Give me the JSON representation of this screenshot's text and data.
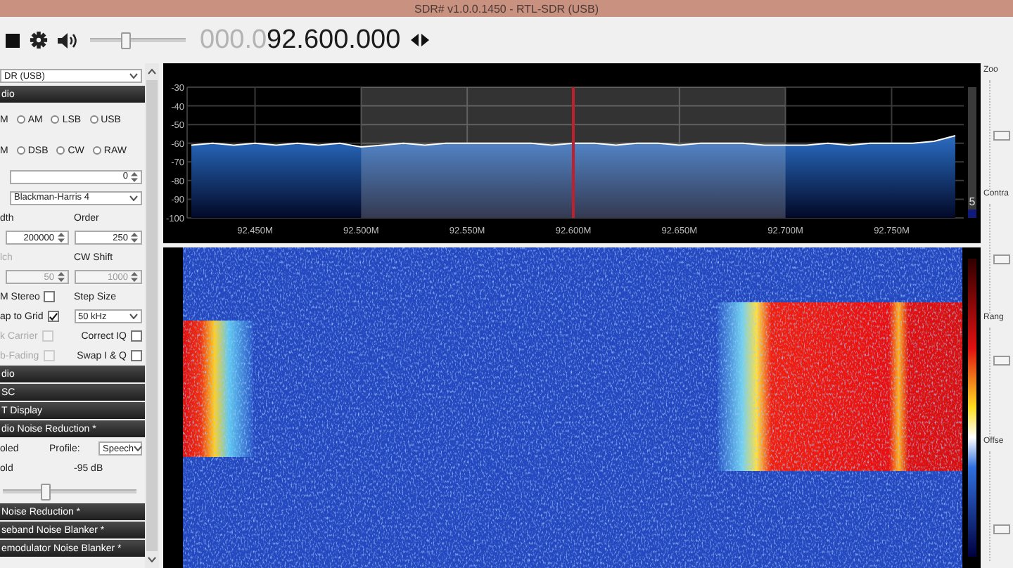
{
  "window": {
    "title": "SDR# v1.0.0.1450 - RTL-SDR (USB)"
  },
  "toolbar": {
    "volume": {
      "level": 0.35
    },
    "frequency_prefix": "000.0",
    "frequency": "92.600.000"
  },
  "left_panel": {
    "items": [
      {
        "kind": "select",
        "value": "DR (USB)"
      },
      {
        "kind": "header",
        "label": "dio"
      },
      {
        "kind": "radios",
        "options": [
          {
            "kind": "clipped",
            "label": "M",
            "selected": false
          },
          {
            "kind": "radio",
            "label": "AM",
            "selected": false
          },
          {
            "kind": "radio",
            "label": "LSB",
            "selected": false
          },
          {
            "kind": "radio",
            "label": "USB",
            "selected": false
          }
        ]
      },
      {
        "kind": "radios",
        "options": [
          {
            "kind": "clipped",
            "label": "M",
            "selected": false
          },
          {
            "kind": "radio",
            "label": "DSB",
            "selected": false
          },
          {
            "kind": "radio",
            "label": "CW",
            "selected": false
          },
          {
            "kind": "radio",
            "label": "RAW",
            "selected": false
          }
        ]
      },
      {
        "kind": "spin-row",
        "value": "0"
      },
      {
        "kind": "select-row",
        "value": "Blackman-Harris 4"
      },
      {
        "kind": "pair",
        "cells": [
          {
            "kind": "text",
            "label": "dth",
            "disabled": false
          },
          {
            "kind": "text",
            "label": "Order",
            "disabled": false
          }
        ]
      },
      {
        "kind": "pair",
        "cells": [
          {
            "kind": "spin",
            "value": "200000",
            "disabled": false
          },
          {
            "kind": "spin",
            "value": "250",
            "disabled": false
          }
        ]
      },
      {
        "kind": "pair",
        "cells": [
          {
            "kind": "text",
            "label": "lch",
            "disabled": true
          },
          {
            "kind": "text",
            "label": "CW Shift",
            "disabled": false
          }
        ]
      },
      {
        "kind": "pair",
        "cells": [
          {
            "kind": "spin",
            "value": "50",
            "disabled": true
          },
          {
            "kind": "spin",
            "value": "1000",
            "disabled": true
          }
        ]
      },
      {
        "kind": "pair",
        "cells": [
          {
            "kind": "check",
            "label": "M Stereo",
            "checked": false,
            "disabled": false
          },
          {
            "kind": "text",
            "label": "Step Size",
            "disabled": false
          }
        ]
      },
      {
        "kind": "pair",
        "cells": [
          {
            "kind": "check",
            "label": "ap to Grid",
            "checked": true,
            "disabled": false
          },
          {
            "kind": "select",
            "value": "50 kHz"
          }
        ]
      },
      {
        "kind": "pair",
        "cells": [
          {
            "kind": "check",
            "label": "k Carrier",
            "checked": false,
            "disabled": true
          },
          {
            "kind": "check",
            "label": "Correct IQ",
            "checked": false,
            "disabled": false
          }
        ]
      },
      {
        "kind": "pair",
        "cells": [
          {
            "kind": "check",
            "label": "b-Fading",
            "checked": false,
            "disabled": true
          },
          {
            "kind": "check",
            "label": "Swap I & Q",
            "checked": false,
            "disabled": false
          }
        ]
      },
      {
        "kind": "header",
        "label": "dio"
      },
      {
        "kind": "header",
        "label": "SC"
      },
      {
        "kind": "header",
        "label": "T Display"
      },
      {
        "kind": "header",
        "label": "dio Noise Reduction *"
      },
      {
        "kind": "pair",
        "cells": [
          {
            "kind": "text",
            "label": "oled",
            "disabled": false
          },
          {
            "kind": "text",
            "label": "Profile:",
            "disabled": false
          },
          {
            "kind": "select",
            "value": "Speech"
          }
        ]
      },
      {
        "kind": "pair",
        "cells": [
          {
            "kind": "text",
            "label": "old",
            "disabled": false
          },
          {
            "kind": "text",
            "label": "-95 dB",
            "disabled": false
          }
        ]
      },
      {
        "kind": "slider",
        "level": 0.3
      },
      {
        "kind": "header",
        "label": "Noise Reduction *"
      },
      {
        "kind": "header",
        "label": "seband Noise Blanker *"
      },
      {
        "kind": "header",
        "label": "emodulator Noise Blanker *"
      }
    ]
  },
  "spectrum": {
    "scale_label": "5",
    "chart_data": {
      "type": "line",
      "x": [
        92.42,
        92.43,
        92.44,
        92.45,
        92.46,
        92.47,
        92.48,
        92.49,
        92.5,
        92.51,
        92.52,
        92.53,
        92.54,
        92.55,
        92.56,
        92.57,
        92.58,
        92.59,
        92.6,
        92.61,
        92.62,
        92.63,
        92.64,
        92.65,
        92.66,
        92.67,
        92.68,
        92.69,
        92.7,
        92.71,
        92.72,
        92.73,
        92.74,
        92.75,
        92.76,
        92.77,
        92.78
      ],
      "series": [
        {
          "color": "#ffffff",
          "values": [
            -61,
            -60,
            -61,
            -60,
            -61,
            -60,
            -61,
            -60,
            -62,
            -61,
            -60,
            -61,
            -60,
            -60,
            -60,
            -60,
            -60,
            -61,
            -60,
            -60,
            -61,
            -60,
            -60,
            -61,
            -60,
            -60,
            -60,
            -61,
            -61,
            -61,
            -60,
            -61,
            -60,
            -60,
            -60,
            -59,
            -56
          ]
        }
      ],
      "xlim": [
        92.418,
        92.784
      ],
      "ylim": [
        -100,
        -30
      ],
      "xticks": [
        {
          "value": 92.45,
          "label": "92.450M"
        },
        {
          "value": 92.5,
          "label": "92.500M"
        },
        {
          "value": 92.55,
          "label": "92.550M"
        },
        {
          "value": 92.6,
          "label": "92.600M"
        },
        {
          "value": 92.65,
          "label": "92.650M"
        },
        {
          "value": 92.7,
          "label": "92.700M"
        },
        {
          "value": 92.75,
          "label": "92.750M"
        }
      ],
      "yticks": [
        -30,
        -40,
        -50,
        -60,
        -70,
        -80,
        -90,
        -100
      ],
      "grid": true,
      "bands": [
        {
          "axis": "x",
          "from": 92.5,
          "to": 92.7
        }
      ],
      "ref_lines": [
        {
          "axis": "x",
          "value": 92.6,
          "color": "#c0202c"
        }
      ]
    }
  },
  "right_panel": {
    "sliders": [
      {
        "label": "Zoo",
        "level": 0.5
      },
      {
        "label": "Contra",
        "level": 0.5
      },
      {
        "label": "Rang",
        "level": 0.7
      },
      {
        "label": "Offse",
        "level": 0.3
      }
    ]
  }
}
